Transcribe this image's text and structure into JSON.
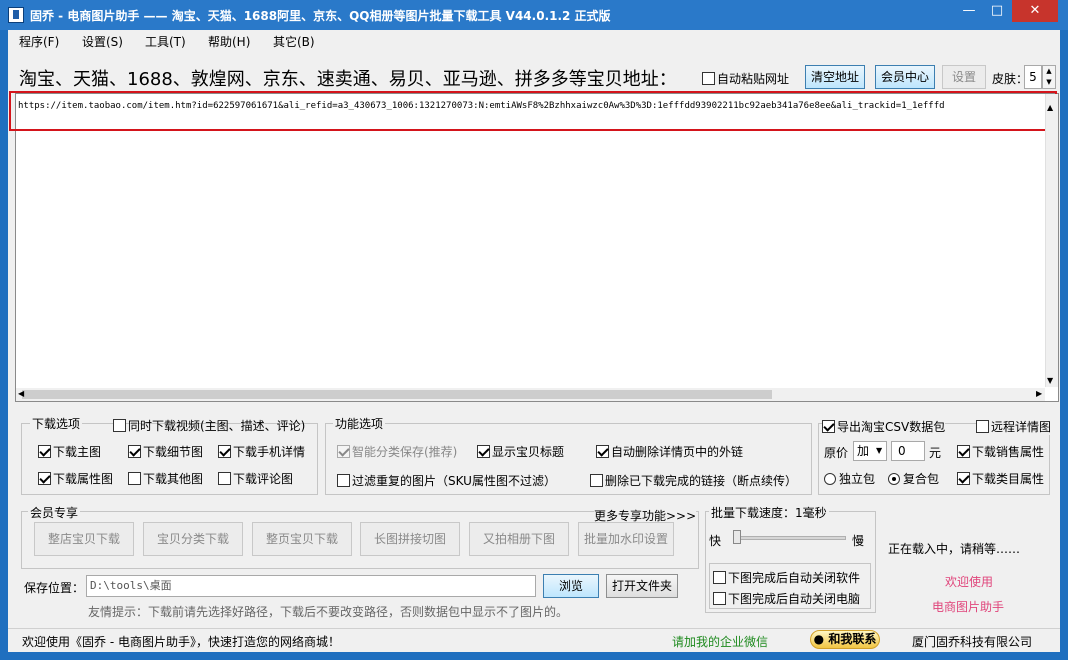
{
  "window": {
    "title": "固乔 - 电商图片助手 —— 淘宝、天猫、1688阿里、京东、QQ相册等图片批量下载工具 V44.0.1.2 正式版",
    "min": "—",
    "max": "□",
    "close": "✕"
  },
  "menu": [
    "程序(F)",
    "设置(S)",
    "工具(T)",
    "帮助(H)",
    "其它(B)"
  ],
  "header": {
    "headline": "淘宝、天猫、1688、敦煌网、京东、速卖通、易贝、亚马逊、拼多多等宝贝地址：",
    "auto_paste": "自动粘贴网址",
    "clear_btn": "清空地址",
    "member_btn": "会员中心",
    "settings_btn": "设置",
    "skin_label": "皮肤：",
    "skin_value": "5"
  },
  "url": {
    "text": "https://item.taobao.com/item.htm?id=622597061671&ali_refid=a3_430673_1006:1321270073:N:emtiAWsF8%2Bzhhxaiwzc0Aw%3D%3D:1efffdd93902211bc92aeb341a76e8ee&ali_trackid=1_1efffd"
  },
  "download_options": {
    "title": "下载选项",
    "video": "同时下载视频(主图、描述、评论)",
    "main_img": "下载主图",
    "detail_img": "下载细节图",
    "mobile_detail": "下载手机详情",
    "attr_img": "下载属性图",
    "other_img": "下载其他图",
    "review_img": "下载评论图"
  },
  "function_options": {
    "title": "功能选项",
    "smart_save": "智能分类保存(推荐)",
    "show_title": "显示宝贝标题",
    "auto_remove_links": "自动删除详情页中的外链",
    "filter_dup": "过滤重复的图片（SKU属性图不过滤）",
    "delete_done": "删除已下载完成的链接（断点续传）"
  },
  "export": {
    "csv": "导出淘宝CSV数据包",
    "remote_detail": "远程详情图",
    "price_label": "原价",
    "price_op": "加",
    "price_value": "0",
    "currency": "元",
    "sales_attr": "下载销售属性",
    "single_pack": "独立包",
    "combo_pack": "复合包",
    "category_attr": "下载类目属性"
  },
  "member": {
    "title": "会员专享",
    "more": "更多专享功能>>>",
    "buttons": [
      "整店宝贝下载",
      "宝贝分类下载",
      "整页宝贝下载",
      "长图拼接切图",
      "又拍相册下图",
      "批量加水印设置"
    ]
  },
  "speed": {
    "title": "批量下载速度：1毫秒",
    "fast": "快",
    "slow": "慢",
    "close_app": "下图完成后自动关闭软件",
    "shutdown": "下图完成后自动关闭电脑"
  },
  "side": {
    "loading": "正在载入中，请稍等……",
    "welcome": "欢迎使用",
    "app_name": "电商图片助手"
  },
  "save": {
    "label": "保存位置：",
    "path": "D:\\tools\\桌面",
    "browse": "浏览",
    "open_folder": "打开文件夹",
    "tip": "友情提示：下载前请先选择好路径，下载后不要改变路径，否则数据包中显示不了图片的。"
  },
  "status": {
    "welcome": "欢迎使用《固乔 - 电商图片助手》，快速打造您的网络商城！",
    "wechat": "请加我的企业微信",
    "contact": "和我联系",
    "company": "厦门固乔科技有限公司"
  },
  "colors": {
    "titlebar": "#2a79c9",
    "highlight": "#d4141b",
    "wechat_green": "#1e8a1e",
    "welcome_pink": "#e0457b"
  }
}
